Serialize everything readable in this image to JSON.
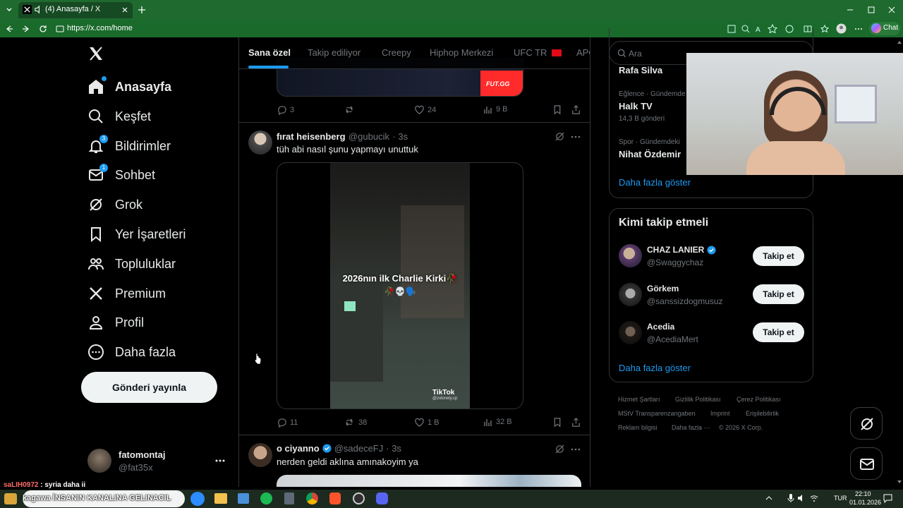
{
  "browser": {
    "tab_title": "(4) Anasayfa / X",
    "url": "https://x.com/home",
    "chat_label": "Chat"
  },
  "nav": {
    "items": [
      {
        "label": "Anasayfa",
        "icon": "home-icon"
      },
      {
        "label": "Keşfet",
        "icon": "search-icon"
      },
      {
        "label": "Bildirimler",
        "icon": "bell-icon",
        "badge": "3"
      },
      {
        "label": "Sohbet",
        "icon": "mail-icon",
        "badge": "1"
      },
      {
        "label": "Grok",
        "icon": "grok-icon"
      },
      {
        "label": "Yer İşaretleri",
        "icon": "bookmark-icon"
      },
      {
        "label": "Topluluklar",
        "icon": "people-icon"
      },
      {
        "label": "Premium",
        "icon": "x-logo-icon"
      },
      {
        "label": "Profil",
        "icon": "person-icon"
      },
      {
        "label": "Daha fazla",
        "icon": "more-circle-icon"
      }
    ],
    "post_button": "Gönderi yayınla",
    "account": {
      "name": "fatomontaj",
      "handle": "@fat35x"
    }
  },
  "feed": {
    "tabs": [
      "Sana özel",
      "Takip ediliyor",
      "Creepy",
      "Hiphop Merkezi",
      "UFC TR",
      "APO"
    ],
    "top_media_label": "FUT.GG",
    "top_actions": {
      "replies": "3",
      "reposts": "",
      "likes": "24",
      "views": "9 B"
    },
    "tweets": [
      {
        "name": "fırat heisenberg",
        "handle": "@gubucik",
        "time": "· 3s",
        "text": "tüh abi nasıl şunu yapmayı unuttuk",
        "video_caption": "2026nın ilk Charlie Kirki🥀",
        "video_emojis": "🥀💀🗣️",
        "watermark": "TikTok",
        "watermark_user": "@zxlonely.cp",
        "replies": "11",
        "reposts": "38",
        "likes": "1 B",
        "views": "32 B"
      },
      {
        "name": "o ciyanno",
        "handle": "@sadeceFJ",
        "time": "· 3s",
        "text": "nerden geldi aklına amınakoyim ya"
      }
    ]
  },
  "right": {
    "search_placeholder": "Ara",
    "trends": [
      {
        "category": "",
        "name": "Rafa Silva",
        "count": ""
      },
      {
        "category": "Eğlence · Gündemde",
        "name": "Halk TV",
        "count": "14,3 B gönderi"
      },
      {
        "category": "Spor · Gündemdeki",
        "name": "Nihat Özdemir",
        "count": ""
      }
    ],
    "show_more": "Daha fazla göster",
    "who_to_follow": {
      "title": "Kimi takip etmeli",
      "users": [
        {
          "name": "CHAZ LANIER",
          "handle": "@Swaggychaz",
          "verified": true
        },
        {
          "name": "Görkem",
          "handle": "@sanssizdogmusuz",
          "verified": false
        },
        {
          "name": "Acedia",
          "handle": "@AcediaMert",
          "verified": false
        }
      ],
      "follow_label": "Takip et",
      "show_more": "Daha fazla göster"
    },
    "footer": [
      "Hizmet Şartları",
      "Gizlilik Politikası",
      "Çerez Politikası",
      "MStV Transparenzangaben",
      "Imprint",
      "Erişilebilirlik",
      "Reklam bilgisi",
      "Daha fazla ···",
      "© 2026 X Corp."
    ]
  },
  "overlay": {
    "chat_user": "saLIH0972",
    "chat_text": ": syria daha ii",
    "ticker": "kagawa  İNSANIN KANALINA GELINACIL"
  },
  "taskbar": {
    "lang": "TUR",
    "time": "22:10",
    "date": "01.01.2026"
  },
  "colors": {
    "accent": "#1d9bf0",
    "border": "#2f3336",
    "muted": "#71767b",
    "browser": "#1f6b2f"
  }
}
